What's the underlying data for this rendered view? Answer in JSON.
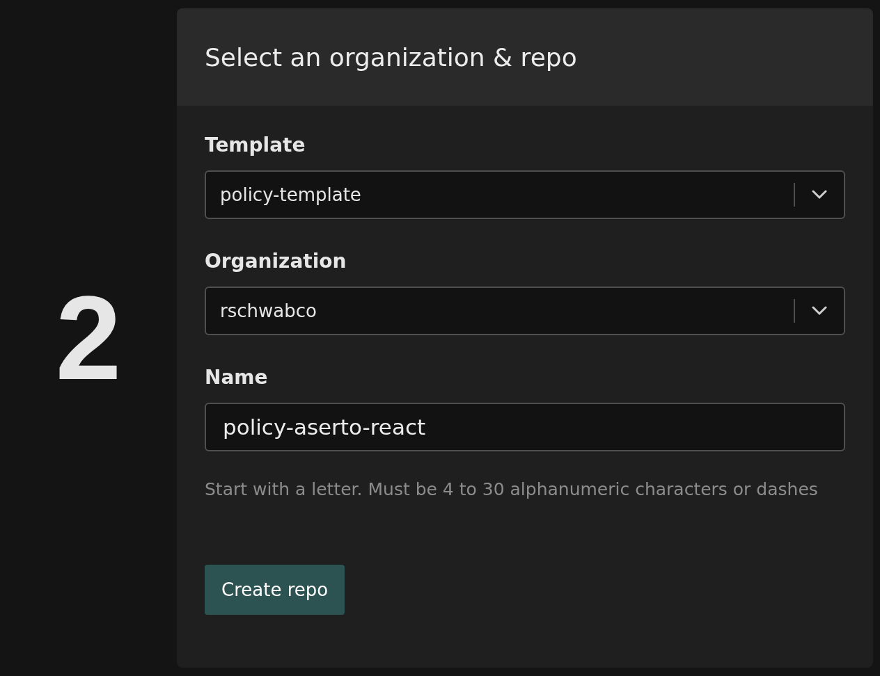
{
  "step": "2",
  "card": {
    "title": "Select an organization & repo",
    "fields": [
      {
        "kind": "select",
        "label": "Template",
        "value": "policy-template"
      },
      {
        "kind": "select",
        "label": "Organization",
        "value": "rschwabco"
      },
      {
        "kind": "input",
        "label": "Name",
        "value": "policy-aserto-react"
      }
    ],
    "hint": "Start with a letter. Must be 4 to 30 alphanumeric characters or dashes",
    "button": "Create repo"
  }
}
